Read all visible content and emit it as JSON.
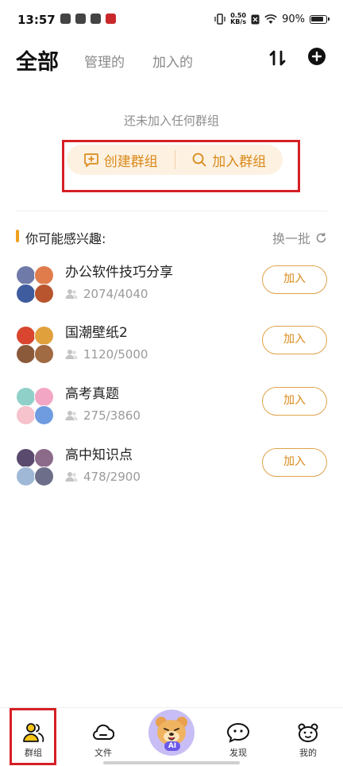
{
  "status_bar": {
    "time": "13:57",
    "net_speed_value": "0.50",
    "net_speed_unit": "KB/s",
    "battery": "90%"
  },
  "header": {
    "title": "全部",
    "tabs": [
      "管理的",
      "加入的"
    ]
  },
  "empty_state": {
    "message": "还未加入任何群组"
  },
  "actions": {
    "create_label": "创建群组",
    "join_label": "加入群组"
  },
  "recommend": {
    "title": "你可能感兴趣:",
    "refresh_label": "换一批",
    "join_label": "加入",
    "groups": [
      {
        "name": "办公软件技巧分享",
        "members": "2074/4040"
      },
      {
        "name": "国潮壁纸2",
        "members": "1120/5000"
      },
      {
        "name": "高考真题",
        "members": "275/3860"
      },
      {
        "name": "高中知识点",
        "members": "478/2900"
      }
    ]
  },
  "bottom_nav": {
    "items": [
      {
        "label": "群组",
        "icon": "people-icon",
        "active": true
      },
      {
        "label": "文件",
        "icon": "cloud-icon",
        "active": false
      },
      {
        "label": "AI",
        "icon": "bear-icon",
        "active": false
      },
      {
        "label": "发现",
        "icon": "chat-face-icon",
        "active": false
      },
      {
        "label": "我的",
        "icon": "bear-face-icon",
        "active": false
      }
    ]
  },
  "colors": {
    "accent": "#e0a24a",
    "accent_text": "#d98a1a",
    "action_bg": "#fdf1e2",
    "highlight": "#d61f26",
    "ai_bg": "#c9bdf5"
  }
}
